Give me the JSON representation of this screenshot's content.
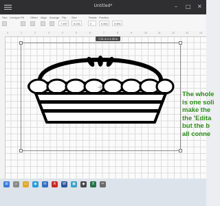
{
  "app": {
    "title": "Untitled*"
  },
  "toolbar": {
    "labels": [
      "Size",
      "Linetype",
      "Fill",
      "Offset",
      "Align",
      "Arrange",
      "Flip",
      "Size",
      "Rotate",
      "Position"
    ],
    "width_value": "7.497",
    "height_value": "6.241",
    "rotate_value": "0",
    "x_value": "0.831",
    "y_value": "0.691"
  },
  "ruler": {
    "ticks": [
      "0",
      "1",
      "2",
      "3",
      "4",
      "5",
      "6",
      "7",
      "8",
      "9",
      "10",
      "11",
      "12",
      "13",
      "14"
    ]
  },
  "canvas": {
    "dimension_badge": "7.51 in x 4.30 in"
  },
  "annotation": {
    "lines": [
      "The whole",
      "is one soli",
      "make the",
      "the 'Edita",
      "but the b",
      "all conne"
    ],
    "color": "#2e8b1a"
  },
  "taskbar": {
    "items": [
      {
        "icon": "start-icon",
        "label": ""
      },
      {
        "icon": "search-icon",
        "label": ""
      },
      {
        "icon": "folder-icon",
        "label": ""
      },
      {
        "icon": "browser-icon",
        "label": ""
      },
      {
        "icon": "mail-icon",
        "label": ""
      },
      {
        "icon": "adobe-icon",
        "label": ""
      },
      {
        "icon": "word-icon",
        "label": ""
      },
      {
        "icon": "photos-icon",
        "label": ""
      },
      {
        "icon": "app-icon",
        "label": ""
      },
      {
        "icon": "excel-icon",
        "label": ""
      },
      {
        "icon": "cut-icon",
        "label": ""
      }
    ]
  }
}
